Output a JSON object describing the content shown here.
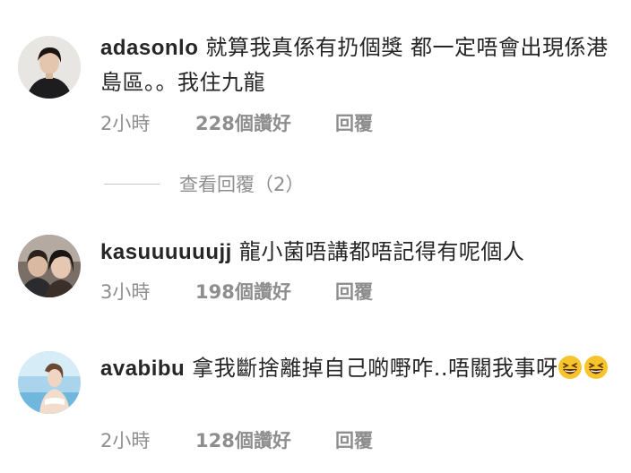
{
  "comments": [
    {
      "username": "adasonlo",
      "text": "就算我真係有扔個獎 都一定唔會出現係港島區。。我住九龍",
      "time": "2小時",
      "likes": "228個讚好",
      "reply": "回覆",
      "avatar": "avatar-adasonlo"
    },
    {
      "username": "kasuuuuuujj",
      "text": "龍小菌唔講都唔記得有呢個人",
      "time": "3小時",
      "likes": "198個讚好",
      "reply": "回覆",
      "avatar": "avatar-kasuuuuuujj"
    },
    {
      "username": "avabibu",
      "text": "拿我斷捨離掉自己啲嘢咋..唔關我事呀",
      "emojis": [
        "laughing-face-emoji",
        "laughing-face-emoji"
      ],
      "time": "2小時",
      "likes": "128個讚好",
      "reply": "回覆",
      "avatar": "avatar-avabibu"
    }
  ],
  "view_replies": {
    "label": "查看回覆（2）"
  },
  "colors": {
    "text": "#262626",
    "secondary": "#8e8e8e",
    "divider": "#c7c7c7"
  }
}
